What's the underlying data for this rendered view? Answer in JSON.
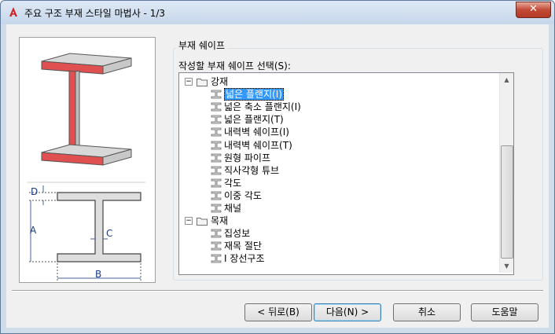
{
  "window": {
    "title": "주요 구조 부재 스타일 마법사 - 1/3",
    "close_label": "✕"
  },
  "group": {
    "title": "부재 쉐이프",
    "select_label": "작성할 부재 쉐이프 선택(S):"
  },
  "preview": {
    "dimension_labels": {
      "d": "D",
      "a": "A",
      "c": "C",
      "b": "B"
    }
  },
  "tree": {
    "categories": [
      {
        "label": "강재",
        "items": [
          "넓은 플랜지(I)",
          "넓은 축소 플랜지(I)",
          "넓은 플랜지(T)",
          "내력벽 쉐이프(I)",
          "내력벽 쉐이프(T)",
          "원형 파이프",
          "직사각형 튜브",
          "각도",
          "이중 각도",
          "채널"
        ]
      },
      {
        "label": "목재",
        "items": [
          "집성보",
          "재목 절단",
          "I 장선구조"
        ]
      }
    ],
    "selected_item": "넓은 플랜지(I)"
  },
  "buttons": {
    "back": "< 뒤로(B)",
    "next": "다음(N) >",
    "cancel": "취소",
    "help": "도움말"
  },
  "colors": {
    "selection": "#3399ff",
    "flange_highlight": "#e05050"
  }
}
